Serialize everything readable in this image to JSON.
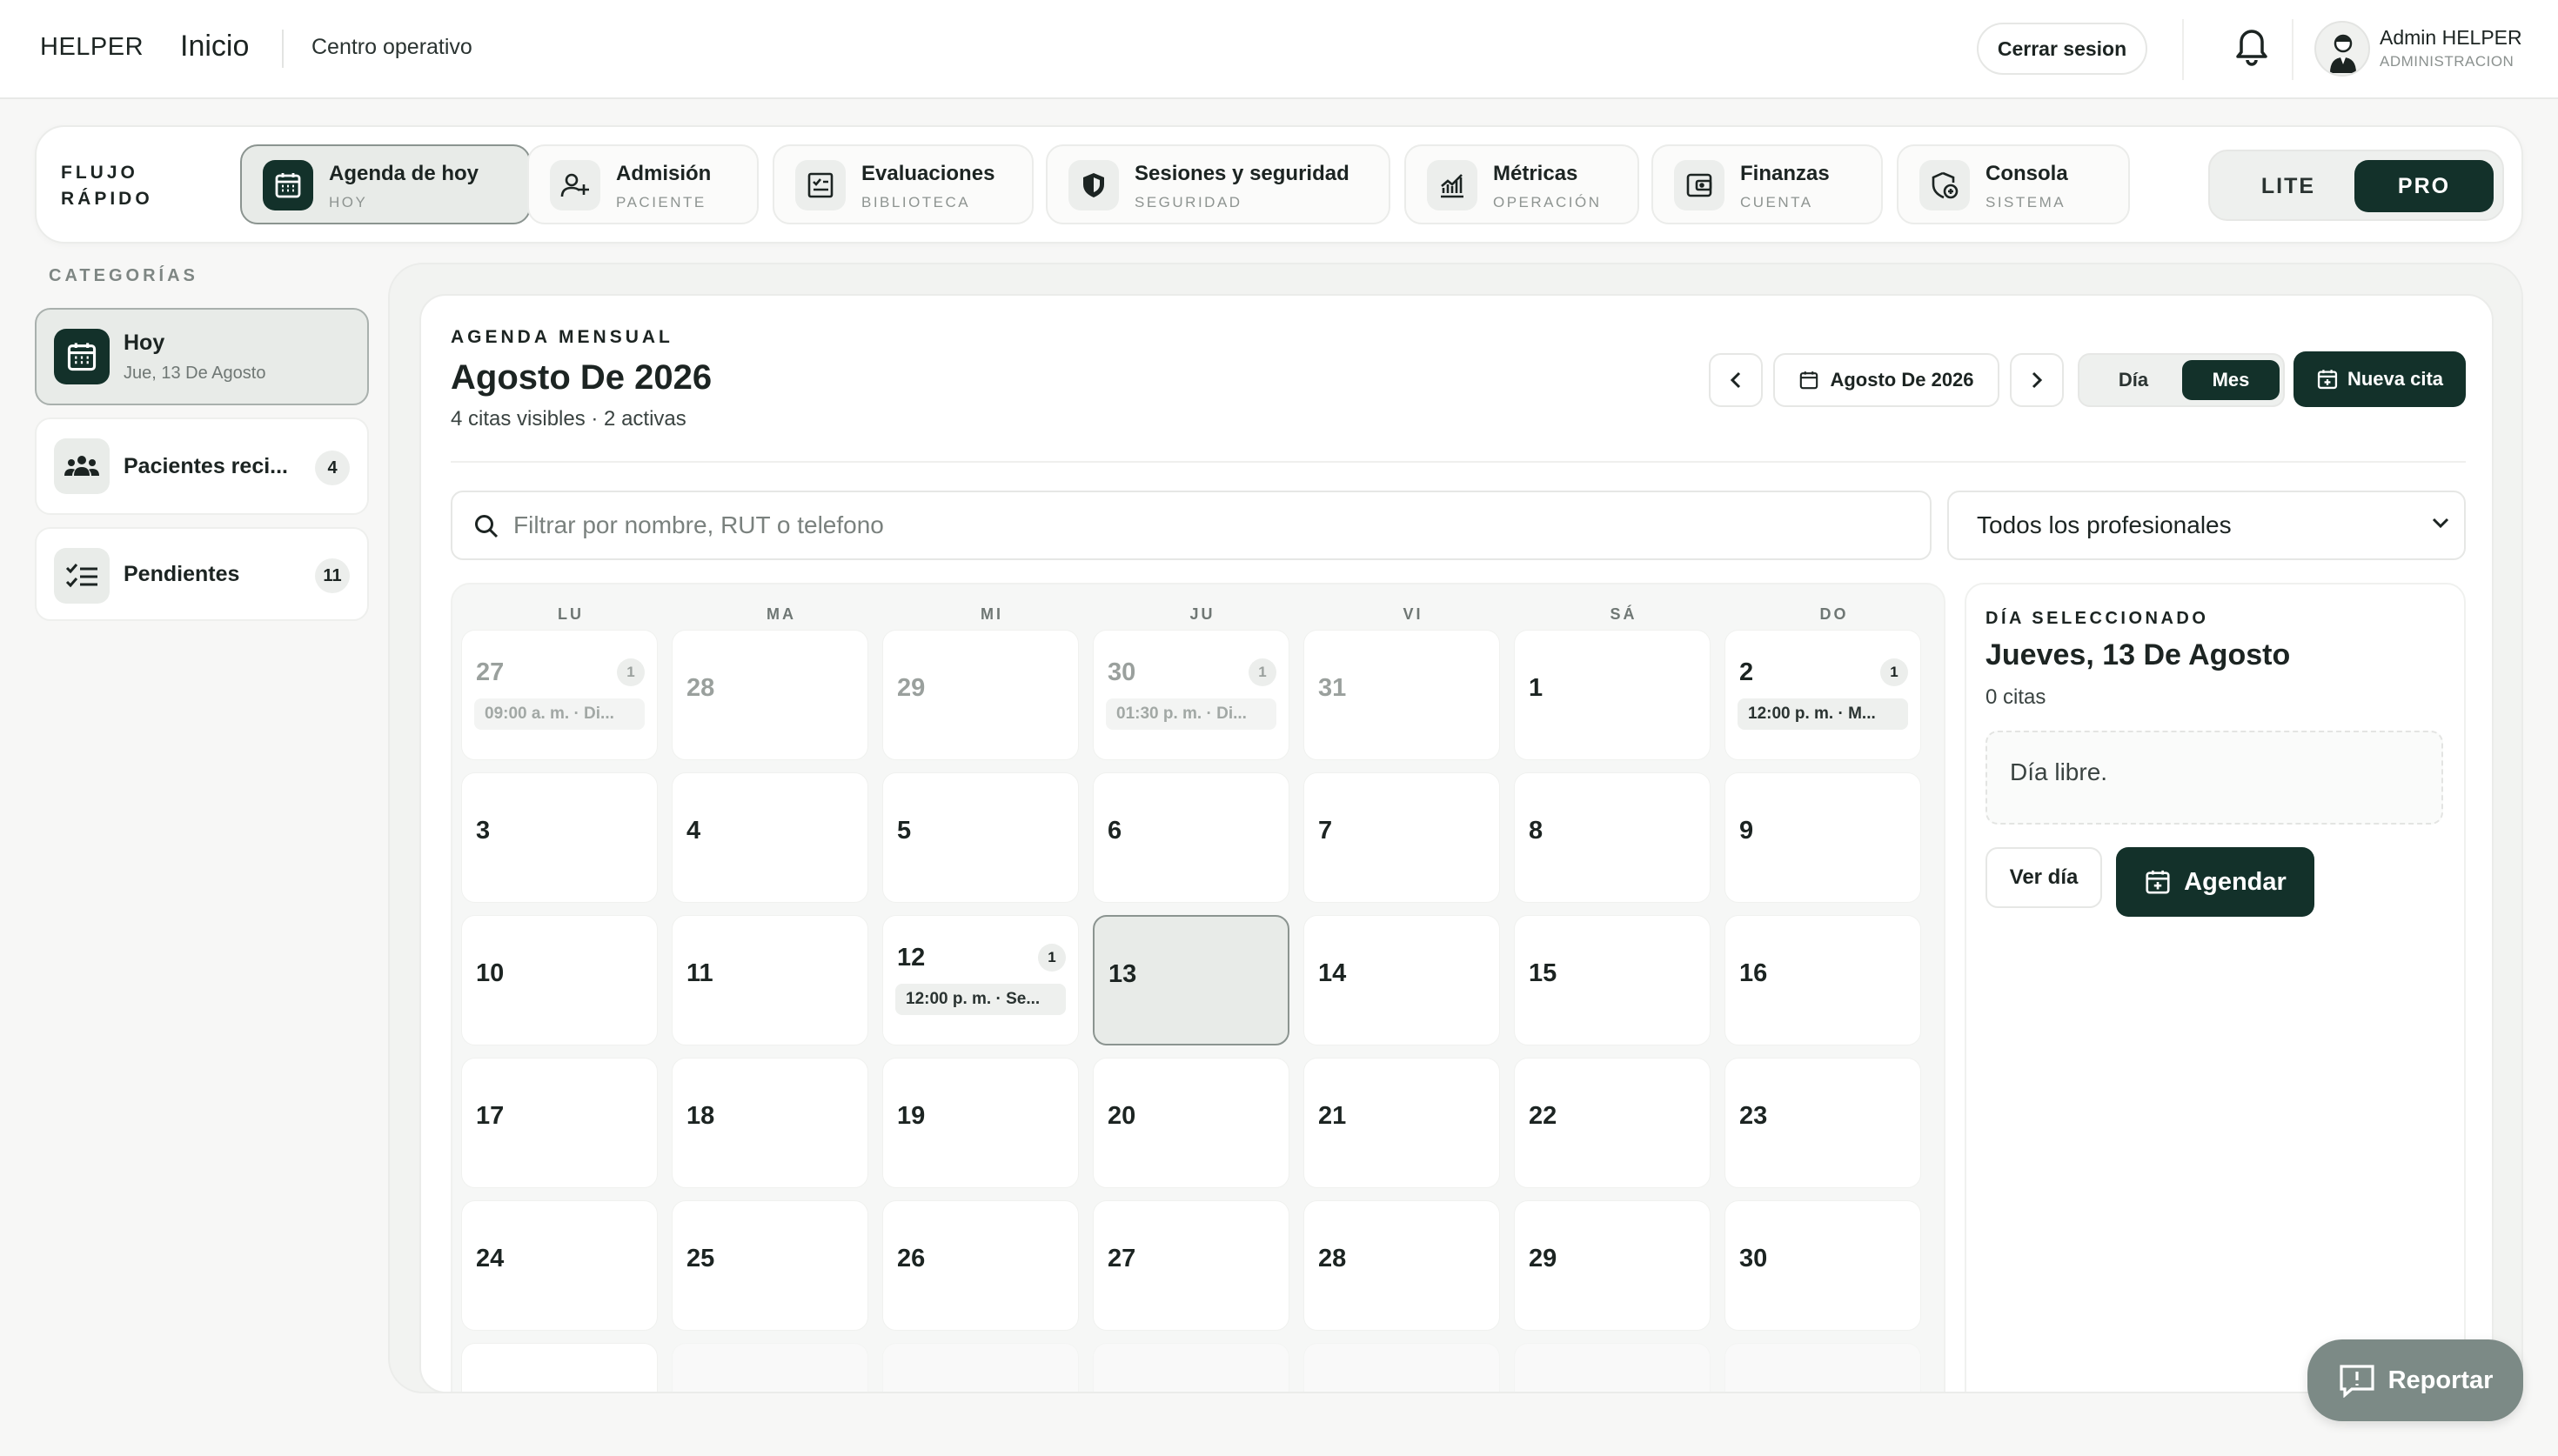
{
  "topnav": {
    "brand": "HELPER",
    "title": "Inicio",
    "subtitle": "Centro operativo",
    "logout_label": "Cerrar sesion",
    "user_name": "Admin HELPER",
    "user_role": "ADMINISTRACION"
  },
  "quick_flow": {
    "label_line1": "FLUJO",
    "label_line2": "RÁPIDO",
    "items": [
      {
        "title": "Agenda de hoy",
        "sub": "HOY",
        "icon": "calendar-icon",
        "active": true
      },
      {
        "title": "Admisión",
        "sub": "PACIENTE",
        "icon": "user-plus-icon",
        "active": false
      },
      {
        "title": "Evaluaciones",
        "sub": "BIBLIOTECA",
        "icon": "checklist-icon",
        "active": false
      },
      {
        "title": "Sesiones y seguridad",
        "sub": "SEGURIDAD",
        "icon": "shield-icon",
        "active": false
      },
      {
        "title": "Métricas",
        "sub": "OPERACIÓN",
        "icon": "chart-icon",
        "active": false
      },
      {
        "title": "Finanzas",
        "sub": "CUENTA",
        "icon": "wallet-icon",
        "active": false
      },
      {
        "title": "Consola",
        "sub": "SISTEMA",
        "icon": "console-icon",
        "active": false
      }
    ],
    "mode_lite": "LITE",
    "mode_pro": "PRO",
    "mode_selected": "PRO"
  },
  "sidebar": {
    "label": "CATEGORÍAS",
    "items": [
      {
        "title": "Hoy",
        "sub": "Jue, 13 De Agosto",
        "icon": "calendar-icon",
        "active": true
      },
      {
        "title": "Pacientes reci...",
        "badge": "4",
        "icon": "users-icon"
      },
      {
        "title": "Pendientes",
        "badge": "11",
        "icon": "tasks-icon"
      }
    ]
  },
  "agenda": {
    "eyebrow": "AGENDA MENSUAL",
    "title": "Agosto De 2026",
    "meta": "4 citas visibles · 2 activas",
    "current_period": "Agosto De 2026",
    "view_day": "Día",
    "view_month": "Mes",
    "view_selected": "Mes",
    "new_label": "Nueva cita",
    "search_placeholder": "Filtrar por nombre, RUT o telefono",
    "professional_filter": "Todos los profesionales"
  },
  "calendar": {
    "weekdays": [
      "LU",
      "MA",
      "MI",
      "JU",
      "VI",
      "SÁ",
      "DO"
    ],
    "weeks": [
      [
        {
          "n": "27",
          "out": true,
          "count": "1",
          "event": "09:00 a. m. · Di..."
        },
        {
          "n": "28",
          "out": true
        },
        {
          "n": "29",
          "out": true
        },
        {
          "n": "30",
          "out": true,
          "count": "1",
          "event": "01:30 p. m. · Di..."
        },
        {
          "n": "31",
          "out": true
        },
        {
          "n": "1"
        },
        {
          "n": "2",
          "count": "1",
          "event": "12:00 p. m. · M..."
        }
      ],
      [
        {
          "n": "3"
        },
        {
          "n": "4"
        },
        {
          "n": "5"
        },
        {
          "n": "6"
        },
        {
          "n": "7"
        },
        {
          "n": "8"
        },
        {
          "n": "9"
        }
      ],
      [
        {
          "n": "10"
        },
        {
          "n": "11"
        },
        {
          "n": "12",
          "count": "1",
          "event": "12:00 p. m. · Se..."
        },
        {
          "n": "13",
          "selected": true
        },
        {
          "n": "14"
        },
        {
          "n": "15"
        },
        {
          "n": "16"
        }
      ],
      [
        {
          "n": "17"
        },
        {
          "n": "18"
        },
        {
          "n": "19"
        },
        {
          "n": "20"
        },
        {
          "n": "21"
        },
        {
          "n": "22"
        },
        {
          "n": "23"
        }
      ],
      [
        {
          "n": "24"
        },
        {
          "n": "25"
        },
        {
          "n": "26"
        },
        {
          "n": "27"
        },
        {
          "n": "28"
        },
        {
          "n": "29"
        },
        {
          "n": "30"
        }
      ]
    ]
  },
  "selected_day": {
    "eyebrow": "DÍA SELECCIONADO",
    "title": "Jueves, 13 De Agosto",
    "count": "0 citas",
    "empty": "Día libre.",
    "view_day": "Ver día",
    "schedule": "Agendar"
  },
  "report_label": "Reportar",
  "colors": {
    "accent": "#13312a",
    "background": "#f7f7f6",
    "surface": "#ffffff",
    "fab": "#7c8a86"
  }
}
